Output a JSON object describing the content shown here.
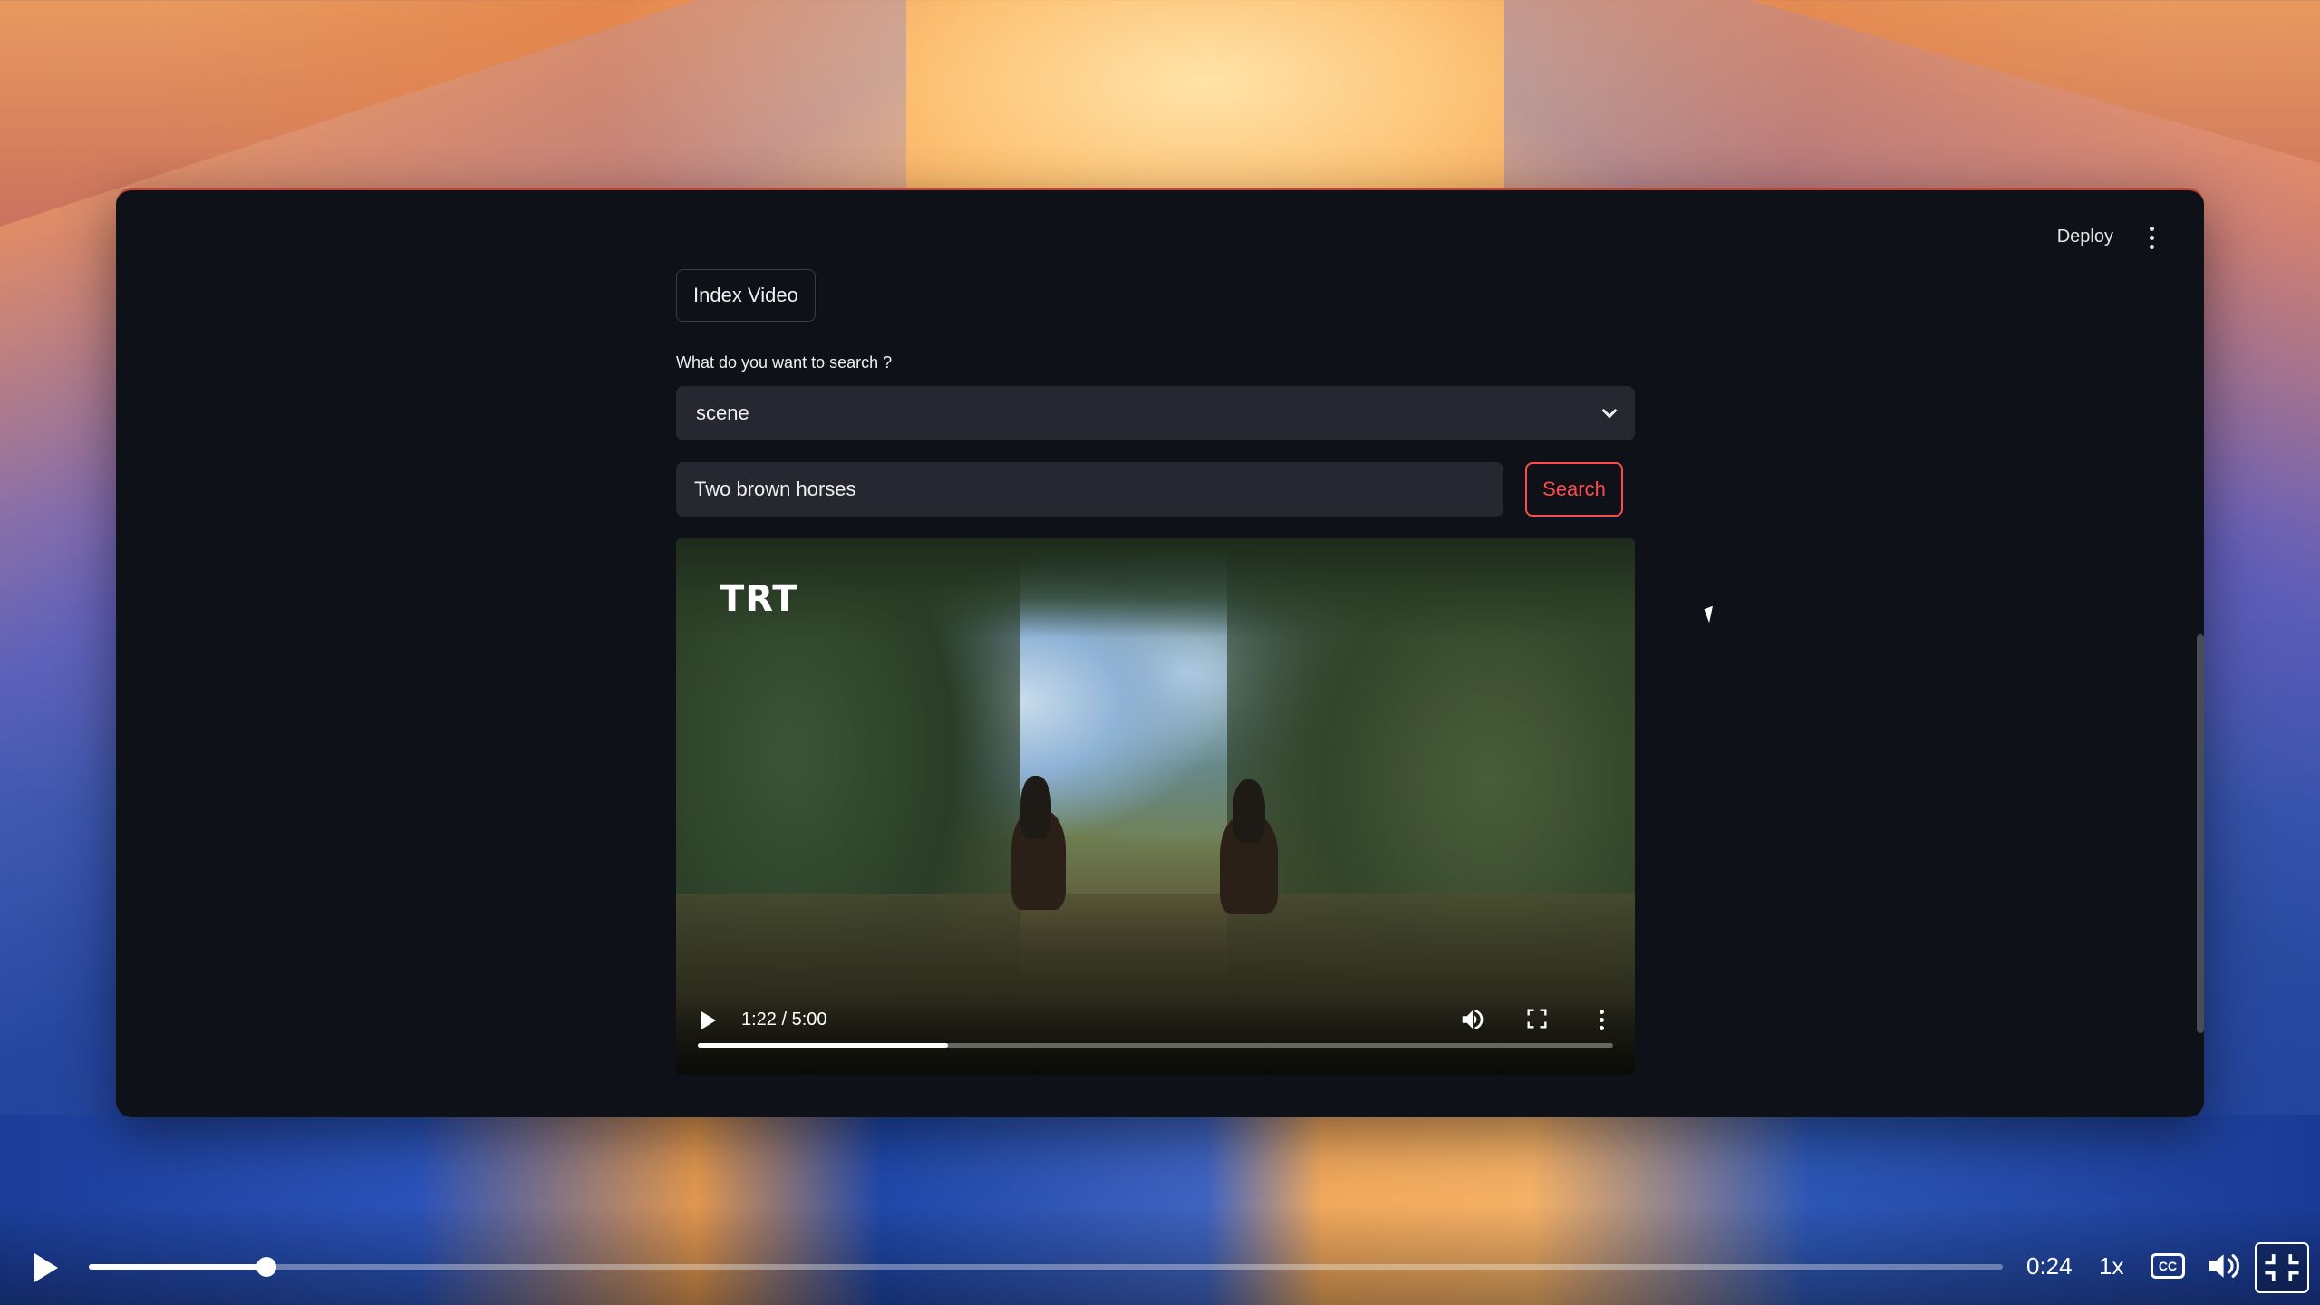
{
  "app": {
    "deploy_label": "Deploy",
    "index_button_label": "Index Video",
    "search_label": "What do you want to search ?",
    "select_value": "scene",
    "query_value": "Two brown horses",
    "search_button_label": "Search"
  },
  "video": {
    "watermark": "TRT",
    "time_display": "1:22 / 5:00",
    "progress": 0.273
  },
  "recording_player": {
    "time": "0:24",
    "speed": "1x",
    "cc_label": "CC",
    "progress": 0.093
  },
  "colors": {
    "app_background": "#0e1117",
    "input_background": "#262730",
    "accent": "#ff4b4b"
  },
  "icons": [
    "kebab-menu-icon",
    "chevron-down-icon",
    "play-icon",
    "volume-icon",
    "fullscreen-icon",
    "more-vert-icon",
    "closed-captions-icon",
    "exit-fullscreen-icon"
  ]
}
